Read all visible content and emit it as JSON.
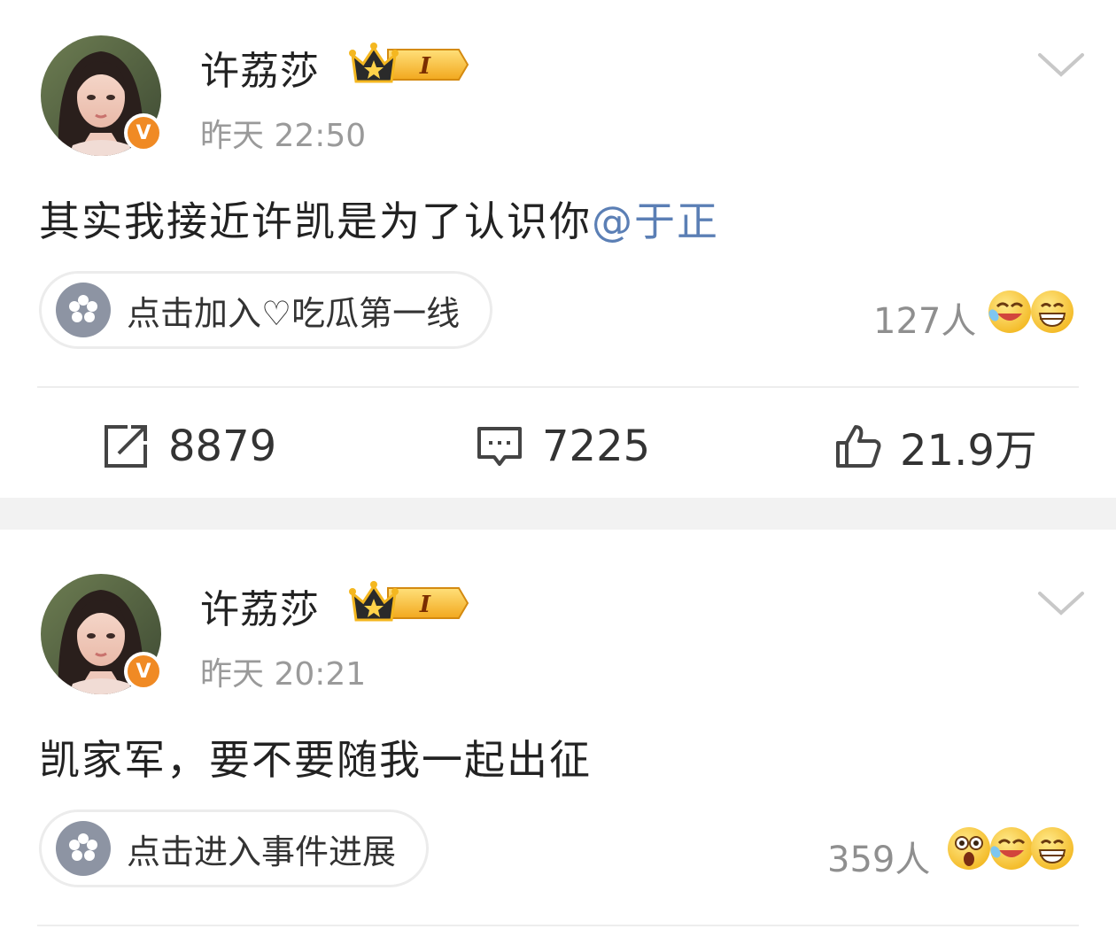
{
  "posts": [
    {
      "username": "许荔莎",
      "level_badge": "I",
      "time": "昨天 22:50",
      "content_text": "其实我接近许凯是为了认识你",
      "mention": "@于正",
      "topic": "点击加入♡吃瓜第一线",
      "reaction_count": "127人",
      "reaction_emojis": [
        "laugh-tears-emoji",
        "grin-emoji"
      ],
      "actions": {
        "repost_count": "8879",
        "comment_count": "7225",
        "like_count": "21.9万"
      }
    },
    {
      "username": "许荔莎",
      "level_badge": "I",
      "time": "昨天 20:21",
      "content_text": "凯家军，要不要随我一起出征",
      "topic": "点击进入事件进展",
      "reaction_count": "359人",
      "reaction_emojis": [
        "shocked-emoji",
        "laugh-tears-emoji",
        "grin-emoji"
      ]
    }
  ],
  "colors": {
    "mention": "#5b7fb5",
    "verified_badge": "#f08a24",
    "timestamp": "#9a9a9a",
    "separator": "#f2f2f2"
  }
}
